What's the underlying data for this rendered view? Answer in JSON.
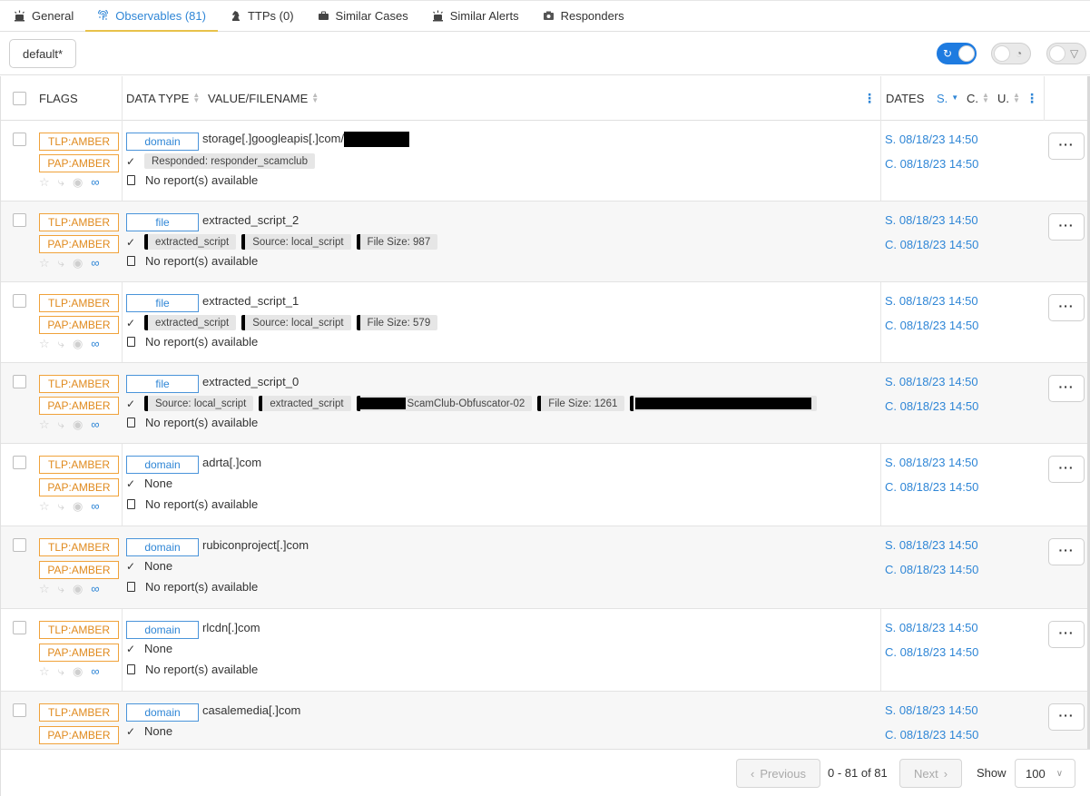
{
  "tabs": [
    {
      "label": "General",
      "icon": "alert-icon"
    },
    {
      "label": "Observables (81)",
      "icon": "fingerprint-icon"
    },
    {
      "label": "TTPs (0)",
      "icon": "chess-knight-icon"
    },
    {
      "label": "Similar Cases",
      "icon": "briefcase-icon"
    },
    {
      "label": "Similar Alerts",
      "icon": "alert-icon"
    },
    {
      "label": "Responders",
      "icon": "camera-icon"
    }
  ],
  "active_tab": "Observables (81)",
  "toolbar": {
    "preset_label": "default*",
    "toggles": [
      {
        "name": "auto-refresh",
        "on": true,
        "icon": "refresh-icon"
      },
      {
        "name": "stats",
        "on": false,
        "icon": "pie-chart-icon"
      },
      {
        "name": "filters",
        "on": false,
        "icon": "filter-icon"
      }
    ]
  },
  "table": {
    "headers": {
      "flags": "FLAGS",
      "data_type": "DATA TYPE",
      "value": "VALUE/FILENAME",
      "dates": "DATES",
      "s": "S.",
      "c": "C.",
      "u": "U."
    },
    "rows": [
      {
        "tlp": "TLP:AMBER",
        "pap": "PAP:AMBER",
        "type": "domain",
        "value": "storage[.]googleapis[.]com/",
        "tags": [
          "Responded: responder_scamclub"
        ],
        "report": "No report(s) available",
        "start": "S. 08/18/23 14:50",
        "created": "C. 08/18/23 14:50"
      },
      {
        "tlp": "TLP:AMBER",
        "pap": "PAP:AMBER",
        "type": "file",
        "value": "extracted_script_2",
        "tags": [
          "extracted_script",
          "Source: local_script",
          "File Size: 987"
        ],
        "report": "No report(s) available",
        "start": "S. 08/18/23 14:50",
        "created": "C. 08/18/23 14:50"
      },
      {
        "tlp": "TLP:AMBER",
        "pap": "PAP:AMBER",
        "type": "file",
        "value": "extracted_script_1",
        "tags": [
          "extracted_script",
          "Source: local_script",
          "File Size: 579"
        ],
        "report": "No report(s) available",
        "start": "S. 08/18/23 14:50",
        "created": "C. 08/18/23 14:50"
      },
      {
        "tlp": "TLP:AMBER",
        "pap": "PAP:AMBER",
        "type": "file",
        "value": "extracted_script_0",
        "tags": [
          "Source: local_script",
          "extracted_script",
          "ScamClub-Obfuscator-02",
          "File Size: 1261"
        ],
        "report": "No report(s) available",
        "start": "S. 08/18/23 14:50",
        "created": "C. 08/18/23 14:50"
      },
      {
        "tlp": "TLP:AMBER",
        "pap": "PAP:AMBER",
        "type": "domain",
        "value": "adrta[.]com",
        "none_label": "None",
        "report": "No report(s) available",
        "start": "S. 08/18/23 14:50",
        "created": "C. 08/18/23 14:50"
      },
      {
        "tlp": "TLP:AMBER",
        "pap": "PAP:AMBER",
        "type": "domain",
        "value": "rubiconproject[.]com",
        "none_label": "None",
        "report": "No report(s) available",
        "start": "S. 08/18/23 14:50",
        "created": "C. 08/18/23 14:50"
      },
      {
        "tlp": "TLP:AMBER",
        "pap": "PAP:AMBER",
        "type": "domain",
        "value": "rlcdn[.]com",
        "none_label": "None",
        "report": "No report(s) available",
        "start": "S. 08/18/23 14:50",
        "created": "C. 08/18/23 14:50"
      },
      {
        "tlp": "TLP:AMBER",
        "pap": "PAP:AMBER",
        "type": "domain",
        "value": "casalemedia[.]com",
        "none_label": "None",
        "start": "S. 08/18/23 14:50",
        "created": "C. 08/18/23 14:50"
      }
    ]
  },
  "pagination": {
    "previous": "Previous",
    "next": "Next",
    "range": "0 - 81 of 81",
    "show_label": "Show",
    "page_size": "100"
  },
  "colors": {
    "accent": "#2f86d6",
    "amber": "#e08a1e",
    "active_tab_underline": "#e8c24a"
  }
}
